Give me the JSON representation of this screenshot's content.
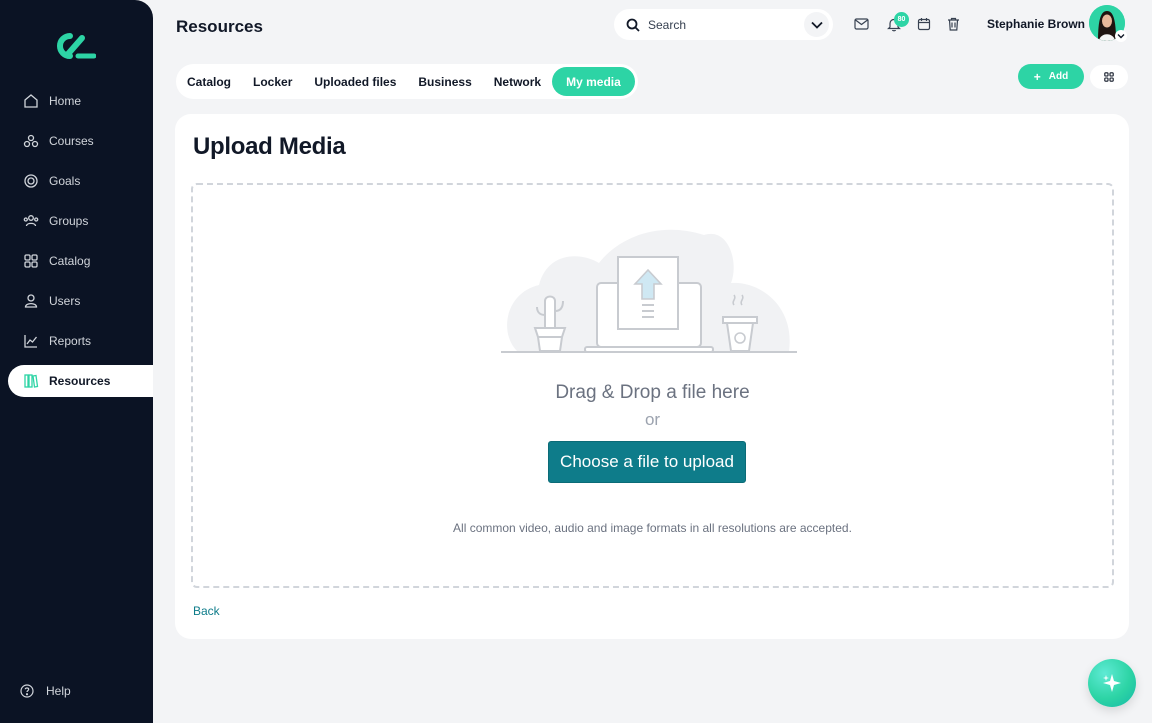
{
  "header": {
    "title": "Resources",
    "search_placeholder": "Search",
    "notification_count": "80",
    "user_name": "Stephanie Brown"
  },
  "sidebar": {
    "items": [
      {
        "label": "Home",
        "icon": "home-icon"
      },
      {
        "label": "Courses",
        "icon": "courses-icon"
      },
      {
        "label": "Goals",
        "icon": "goals-icon"
      },
      {
        "label": "Groups",
        "icon": "groups-icon"
      },
      {
        "label": "Catalog",
        "icon": "catalog-icon"
      },
      {
        "label": "Users",
        "icon": "users-icon"
      },
      {
        "label": "Reports",
        "icon": "reports-icon"
      },
      {
        "label": "Resources",
        "icon": "resources-icon",
        "active": true
      }
    ],
    "help_label": "Help"
  },
  "tabs": [
    "Catalog",
    "Locker",
    "Uploaded files",
    "Business",
    "Network",
    "My media"
  ],
  "active_tab": "My media",
  "toolbar": {
    "add_label": "Add"
  },
  "upload": {
    "title": "Upload Media",
    "drag_text": "Drag & Drop a file here",
    "or_text": "or",
    "choose_label": "Choose a file to upload",
    "note": "All common video, audio and image formats in all resolutions are accepted.",
    "back_label": "Back"
  },
  "colors": {
    "accent": "#2dd4a5",
    "sidebar_bg": "#0b1324",
    "upload_button": "#0e7c8a"
  }
}
